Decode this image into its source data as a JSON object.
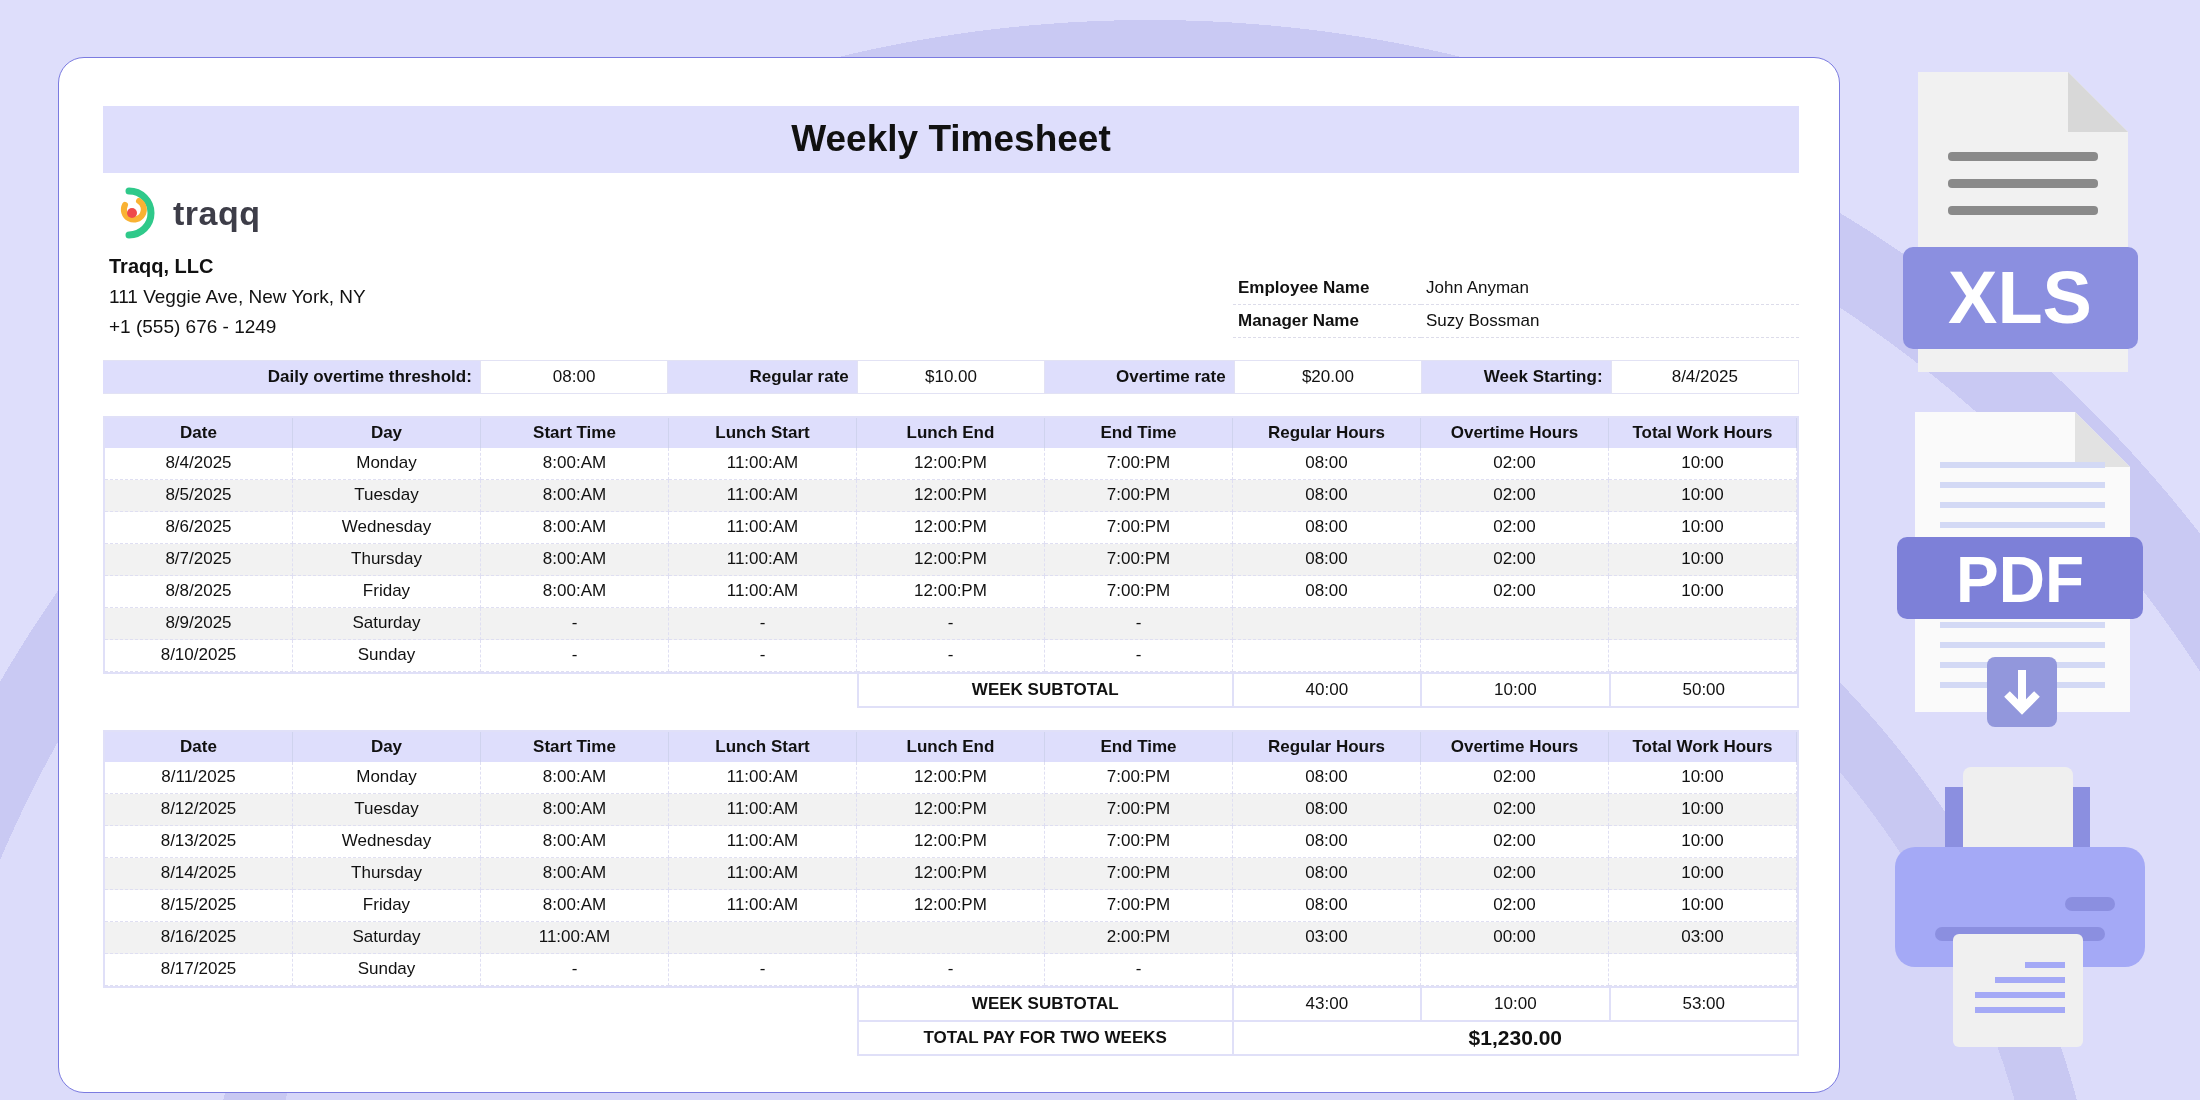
{
  "title": "Weekly Timesheet",
  "logo": {
    "text": "traqq"
  },
  "company": {
    "name": "Traqq, LLC",
    "address": "111 Veggie Ave, New York, NY",
    "phone": "+1 (555) 676 - 1249"
  },
  "people": [
    {
      "label": "Employee Name",
      "value": "John Anyman"
    },
    {
      "label": "Manager Name",
      "value": "Suzy Bossman"
    }
  ],
  "settings": [
    {
      "label": "Daily overtime threshold:",
      "value": "08:00"
    },
    {
      "label": "Regular rate",
      "value": "$10.00"
    },
    {
      "label": "Overtime rate",
      "value": "$20.00"
    },
    {
      "label": "Week Starting:",
      "value": "8/4/2025"
    }
  ],
  "weeks": [
    {
      "columns": [
        "Date",
        "Day",
        "Start Time",
        "Lunch Start",
        "Lunch End",
        "End Time",
        "Regular Hours",
        "Overtime Hours",
        "Total Work Hours"
      ],
      "rows": [
        [
          "8/4/2025",
          "Monday",
          "8:00:AM",
          "11:00:AM",
          "12:00:PM",
          "7:00:PM",
          "08:00",
          "02:00",
          "10:00"
        ],
        [
          "8/5/2025",
          "Tuesday",
          "8:00:AM",
          "11:00:AM",
          "12:00:PM",
          "7:00:PM",
          "08:00",
          "02:00",
          "10:00"
        ],
        [
          "8/6/2025",
          "Wednesday",
          "8:00:AM",
          "11:00:AM",
          "12:00:PM",
          "7:00:PM",
          "08:00",
          "02:00",
          "10:00"
        ],
        [
          "8/7/2025",
          "Thursday",
          "8:00:AM",
          "11:00:AM",
          "12:00:PM",
          "7:00:PM",
          "08:00",
          "02:00",
          "10:00"
        ],
        [
          "8/8/2025",
          "Friday",
          "8:00:AM",
          "11:00:AM",
          "12:00:PM",
          "7:00:PM",
          "08:00",
          "02:00",
          "10:00"
        ],
        [
          "8/9/2025",
          "Saturday",
          "-",
          "-",
          "-",
          "-",
          null,
          null,
          null
        ],
        [
          "8/10/2025",
          "Sunday",
          "-",
          "-",
          "-",
          "-",
          null,
          null,
          null
        ]
      ],
      "subtotal": {
        "label": "WEEK SUBTOTAL",
        "values": [
          "40:00",
          "10:00",
          "50:00"
        ]
      }
    },
    {
      "columns": [
        "Date",
        "Day",
        "Start Time",
        "Lunch Start",
        "Lunch End",
        "End Time",
        "Regular Hours",
        "Overtime Hours",
        "Total Work Hours"
      ],
      "rows": [
        [
          "8/11/2025",
          "Monday",
          "8:00:AM",
          "11:00:AM",
          "12:00:PM",
          "7:00:PM",
          "08:00",
          "02:00",
          "10:00"
        ],
        [
          "8/12/2025",
          "Tuesday",
          "8:00:AM",
          "11:00:AM",
          "12:00:PM",
          "7:00:PM",
          "08:00",
          "02:00",
          "10:00"
        ],
        [
          "8/13/2025",
          "Wednesday",
          "8:00:AM",
          "11:00:AM",
          "12:00:PM",
          "7:00:PM",
          "08:00",
          "02:00",
          "10:00"
        ],
        [
          "8/14/2025",
          "Thursday",
          "8:00:AM",
          "11:00:AM",
          "12:00:PM",
          "7:00:PM",
          "08:00",
          "02:00",
          "10:00"
        ],
        [
          "8/15/2025",
          "Friday",
          "8:00:AM",
          "11:00:AM",
          "12:00:PM",
          "7:00:PM",
          "08:00",
          "02:00",
          "10:00"
        ],
        [
          "8/16/2025",
          "Saturday",
          "11:00:AM",
          null,
          null,
          "2:00:PM",
          "03:00",
          "00:00",
          "03:00"
        ],
        [
          "8/17/2025",
          "Sunday",
          "-",
          "-",
          "-",
          "-",
          null,
          null,
          null
        ]
      ],
      "subtotal": {
        "label": "WEEK SUBTOTAL",
        "values": [
          "43:00",
          "10:00",
          "53:00"
        ]
      }
    }
  ],
  "total": {
    "label": "TOTAL PAY FOR TWO WEEKS",
    "value": "$1,230.00"
  },
  "exports": [
    {
      "kind": "xls",
      "label": "XLS"
    },
    {
      "kind": "pdf",
      "label": "PDF"
    },
    {
      "kind": "print"
    }
  ]
}
